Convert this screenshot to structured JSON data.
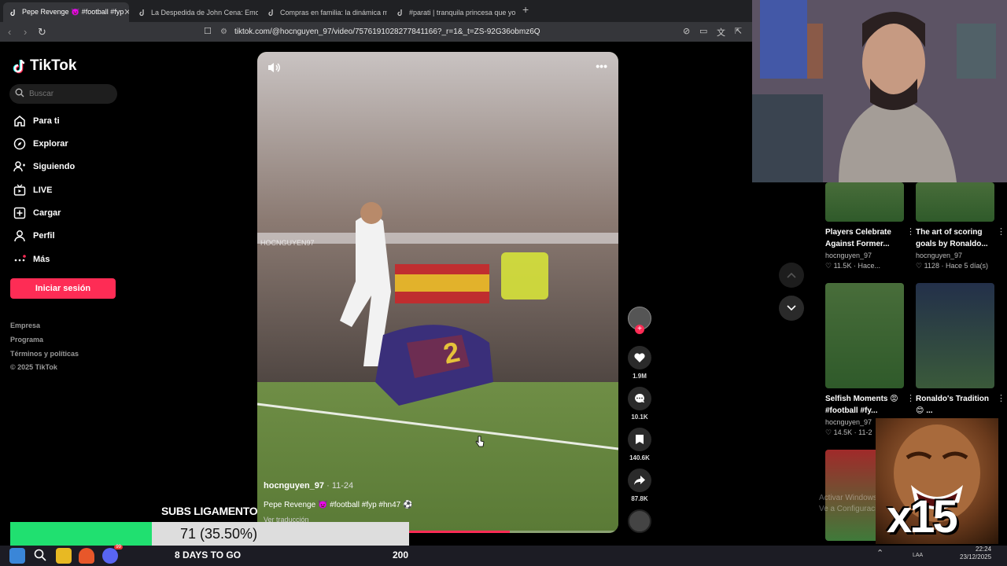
{
  "browser": {
    "tabs": [
      {
        "title": "Pepe Revenge 👿 #football #fyp",
        "active": true
      },
      {
        "title": "La Despedida de John Cena: Emoción",
        "active": false
      },
      {
        "title": "Compras en familia: la dinámica man",
        "active": false
      },
      {
        "title": "#parati | tranquila princesa que yo se",
        "active": false
      }
    ],
    "url": "tiktok.com/@hocnguyen_97/video/7576191028277841166?_r=1&_t=ZS-92G36obmz6Q"
  },
  "sidebar": {
    "brand": "TikTok",
    "search_placeholder": "Buscar",
    "nav": [
      {
        "label": "Para ti",
        "icon": "home-icon"
      },
      {
        "label": "Explorar",
        "icon": "compass-icon"
      },
      {
        "label": "Siguiendo",
        "icon": "following-icon"
      },
      {
        "label": "LIVE",
        "icon": "live-icon"
      },
      {
        "label": "Cargar",
        "icon": "upload-icon"
      },
      {
        "label": "Perfil",
        "icon": "profile-icon"
      },
      {
        "label": "Más",
        "icon": "more-icon"
      }
    ],
    "login_label": "Iniciar sesión",
    "footer": [
      "Empresa",
      "Programa",
      "Términos y políticas",
      "© 2025 TikTok"
    ]
  },
  "video": {
    "watermark": "HOCNGUYEN97",
    "jersey_number": "2",
    "author": "hocnguyen_97",
    "date": "11-24",
    "description": "Pepe Revenge 👿 #football #fyp #hn47 ⚽",
    "translate_label": "Ver traducción",
    "progress_fraction": 0.7
  },
  "actions": [
    {
      "name": "likes",
      "count": "1.9M"
    },
    {
      "name": "comments",
      "count": "10.1K"
    },
    {
      "name": "saves",
      "count": "140.6K"
    },
    {
      "name": "shares",
      "count": "87.8K"
    }
  ],
  "recommendations": [
    {
      "title": "Players Celebrate Against Former...",
      "author": "hocnguyen_97",
      "likes": "11.5K",
      "time": "Hace..."
    },
    {
      "title": "The art of scoring goals by Ronaldo...",
      "author": "hocnguyen_97",
      "likes": "1128",
      "time": "Hace 5 día(s)"
    },
    {
      "title": "Selfish Moments 😡 #football #fy...",
      "author": "hocnguyen_97",
      "likes": "14.5K",
      "time": "11-2"
    },
    {
      "title": "Ronaldo's Tradition 😊 ...",
      "author": "",
      "likes": "",
      "time": ""
    }
  ],
  "stream_overlay": {
    "subs_label": "SUBS LIGAMENTO",
    "goal_text": "71 (35.50%)",
    "goal_fraction": 0.355,
    "days_label": "8 DAYS TO GO",
    "goal_target": "200",
    "meme_text": "x15",
    "windows_watermark_line1": "Activar Windows",
    "windows_watermark_line2": "Ve a Configuración"
  },
  "system": {
    "time": "22:24",
    "date": "23/12/2025",
    "lang": "LAA",
    "discord_badge": "99"
  },
  "colors": {
    "accent": "#fe2c55",
    "goal_fill": "#20e070"
  }
}
